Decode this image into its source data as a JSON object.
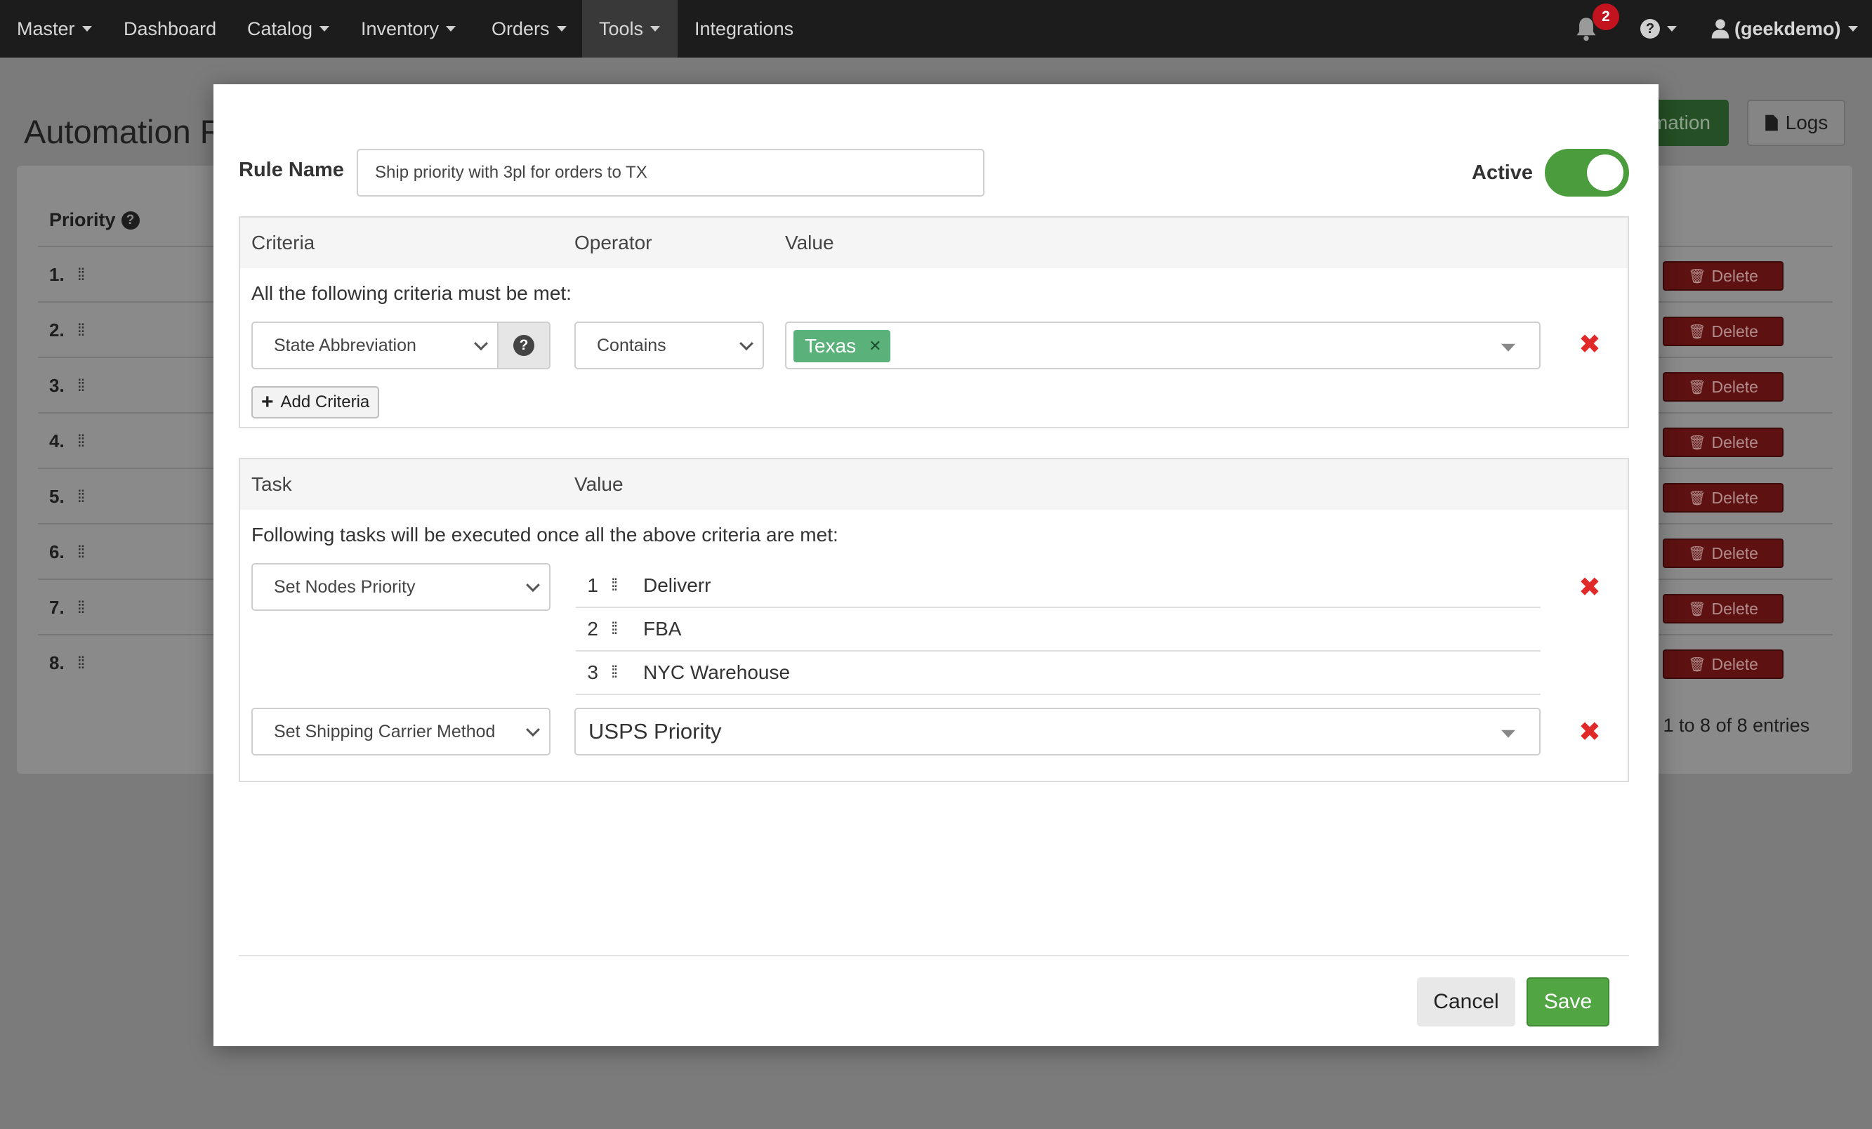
{
  "navbar": {
    "items": [
      {
        "label": "Master",
        "caret": true
      },
      {
        "label": "Dashboard",
        "caret": false
      },
      {
        "label": "Catalog",
        "caret": true
      },
      {
        "label": "Inventory",
        "caret": true
      },
      {
        "label": "Orders",
        "caret": true
      },
      {
        "label": "Tools",
        "caret": true,
        "active": true
      },
      {
        "label": "Integrations",
        "caret": false
      }
    ],
    "notification_count": "2",
    "user_label": "(geekdemo)"
  },
  "background": {
    "page_title": "Automation R",
    "add_button_label": "mation",
    "logs_button_label": "Logs",
    "priority_header": "Priority",
    "rows": [
      "1.",
      "2.",
      "3.",
      "4.",
      "5.",
      "6.",
      "7.",
      "8."
    ],
    "delete_label": "Delete",
    "entries_text": "g 1 to 8 of 8 entries"
  },
  "modal": {
    "rule_name_label": "Rule Name",
    "rule_name_value": "Ship priority with 3pl for orders to TX",
    "active_label": "Active",
    "active": true,
    "criteria_section": {
      "headers": {
        "criteria": "Criteria",
        "operator": "Operator",
        "value": "Value"
      },
      "intro": "All the following criteria must be met:",
      "criteria_field": "State Abbreviation",
      "operator": "Contains",
      "value_tag": "Texas",
      "add_criteria_label": "Add Criteria"
    },
    "task_section": {
      "headers": {
        "task": "Task",
        "value": "Value"
      },
      "intro": "Following tasks will be executed once all the above criteria are met:",
      "task1": {
        "name": "Set Nodes Priority",
        "nodes": [
          {
            "num": "1",
            "label": "Deliverr"
          },
          {
            "num": "2",
            "label": "FBA"
          },
          {
            "num": "3",
            "label": "NYC Warehouse"
          }
        ]
      },
      "task2": {
        "name": "Set Shipping Carrier Method",
        "value": "USPS Priority"
      }
    },
    "cancel_label": "Cancel",
    "save_label": "Save"
  },
  "colors": {
    "navbar_bg": "#1c1c1c",
    "success_green": "#51a543",
    "tag_green": "#5ab27a",
    "danger_red": "#e02a2a",
    "badge_red": "#c3131f"
  }
}
